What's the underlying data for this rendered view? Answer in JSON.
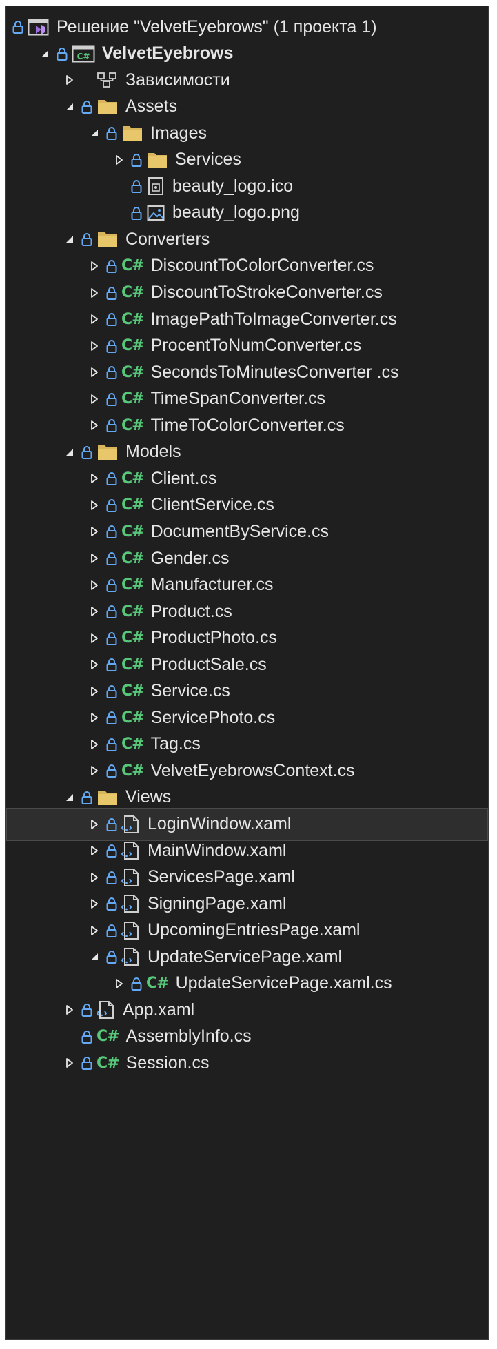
{
  "colors": {
    "background": "#1f1f1f",
    "text": "#e6e6e6",
    "lock_blue": "#64a9f5",
    "folder_yellow": "#d8b55a",
    "csharp_green": "#57c87a",
    "selection": "#2e2e2e"
  },
  "tree": [
    {
      "name": "Решение \"VelvetEyebrows\"  (1 проекта 1)",
      "depth": 0,
      "expander": "none",
      "icon": "solution-icon",
      "lock": true
    },
    {
      "name": "VelvetEyebrows",
      "depth": 1,
      "expander": "expanded",
      "icon": "csharp-project-icon",
      "lock": true,
      "bold": true
    },
    {
      "name": "Зависимости",
      "depth": 2,
      "expander": "collapsed",
      "icon": "dependencies-icon",
      "lock": false
    },
    {
      "name": "Assets",
      "depth": 2,
      "expander": "expanded",
      "icon": "folder-icon",
      "lock": true
    },
    {
      "name": "Images",
      "depth": 3,
      "expander": "expanded",
      "icon": "folder-icon",
      "lock": true
    },
    {
      "name": "Services",
      "depth": 4,
      "expander": "collapsed",
      "icon": "folder-icon",
      "lock": true
    },
    {
      "name": "beauty_logo.ico",
      "depth": 4,
      "expander": "none",
      "icon": "ico-file-icon",
      "lock": true
    },
    {
      "name": "beauty_logo.png",
      "depth": 4,
      "expander": "none",
      "icon": "image-file-icon",
      "lock": true
    },
    {
      "name": "Converters",
      "depth": 2,
      "expander": "expanded",
      "icon": "folder-icon",
      "lock": true
    },
    {
      "name": "DiscountToColorConverter.cs",
      "depth": 3,
      "expander": "collapsed",
      "icon": "csharp-file-icon",
      "lock": true
    },
    {
      "name": "DiscountToStrokeConverter.cs",
      "depth": 3,
      "expander": "collapsed",
      "icon": "csharp-file-icon",
      "lock": true
    },
    {
      "name": "ImagePathToImageConverter.cs",
      "depth": 3,
      "expander": "collapsed",
      "icon": "csharp-file-icon",
      "lock": true
    },
    {
      "name": "ProcentToNumConverter.cs",
      "depth": 3,
      "expander": "collapsed",
      "icon": "csharp-file-icon",
      "lock": true
    },
    {
      "name": "SecondsToMinutesConverter .cs",
      "depth": 3,
      "expander": "collapsed",
      "icon": "csharp-file-icon",
      "lock": true
    },
    {
      "name": "TimeSpanConverter.cs",
      "depth": 3,
      "expander": "collapsed",
      "icon": "csharp-file-icon",
      "lock": true
    },
    {
      "name": "TimeToColorConverter.cs",
      "depth": 3,
      "expander": "collapsed",
      "icon": "csharp-file-icon",
      "lock": true
    },
    {
      "name": "Models",
      "depth": 2,
      "expander": "expanded",
      "icon": "folder-icon",
      "lock": true
    },
    {
      "name": "Client.cs",
      "depth": 3,
      "expander": "collapsed",
      "icon": "csharp-file-icon",
      "lock": true
    },
    {
      "name": "ClientService.cs",
      "depth": 3,
      "expander": "collapsed",
      "icon": "csharp-file-icon",
      "lock": true
    },
    {
      "name": "DocumentByService.cs",
      "depth": 3,
      "expander": "collapsed",
      "icon": "csharp-file-icon",
      "lock": true
    },
    {
      "name": "Gender.cs",
      "depth": 3,
      "expander": "collapsed",
      "icon": "csharp-file-icon",
      "lock": true
    },
    {
      "name": "Manufacturer.cs",
      "depth": 3,
      "expander": "collapsed",
      "icon": "csharp-file-icon",
      "lock": true
    },
    {
      "name": "Product.cs",
      "depth": 3,
      "expander": "collapsed",
      "icon": "csharp-file-icon",
      "lock": true
    },
    {
      "name": "ProductPhoto.cs",
      "depth": 3,
      "expander": "collapsed",
      "icon": "csharp-file-icon",
      "lock": true
    },
    {
      "name": "ProductSale.cs",
      "depth": 3,
      "expander": "collapsed",
      "icon": "csharp-file-icon",
      "lock": true
    },
    {
      "name": "Service.cs",
      "depth": 3,
      "expander": "collapsed",
      "icon": "csharp-file-icon",
      "lock": true
    },
    {
      "name": "ServicePhoto.cs",
      "depth": 3,
      "expander": "collapsed",
      "icon": "csharp-file-icon",
      "lock": true
    },
    {
      "name": "Tag.cs",
      "depth": 3,
      "expander": "collapsed",
      "icon": "csharp-file-icon",
      "lock": true
    },
    {
      "name": "VelvetEyebrowsContext.cs",
      "depth": 3,
      "expander": "collapsed",
      "icon": "csharp-file-icon",
      "lock": true
    },
    {
      "name": "Views",
      "depth": 2,
      "expander": "expanded",
      "icon": "folder-icon",
      "lock": true
    },
    {
      "name": "LoginWindow.xaml",
      "depth": 3,
      "expander": "collapsed",
      "icon": "xaml-file-icon",
      "lock": true,
      "selected": true
    },
    {
      "name": "MainWindow.xaml",
      "depth": 3,
      "expander": "collapsed",
      "icon": "xaml-file-icon",
      "lock": true
    },
    {
      "name": "ServicesPage.xaml",
      "depth": 3,
      "expander": "collapsed",
      "icon": "xaml-file-icon",
      "lock": true
    },
    {
      "name": "SigningPage.xaml",
      "depth": 3,
      "expander": "collapsed",
      "icon": "xaml-file-icon",
      "lock": true
    },
    {
      "name": "UpcomingEntriesPage.xaml",
      "depth": 3,
      "expander": "collapsed",
      "icon": "xaml-file-icon",
      "lock": true
    },
    {
      "name": "UpdateServicePage.xaml",
      "depth": 3,
      "expander": "expanded",
      "icon": "xaml-file-icon",
      "lock": true
    },
    {
      "name": "UpdateServicePage.xaml.cs",
      "depth": 4,
      "expander": "collapsed",
      "icon": "csharp-file-icon",
      "lock": true
    },
    {
      "name": "App.xaml",
      "depth": 2,
      "expander": "collapsed",
      "icon": "xaml-file-icon",
      "lock": true
    },
    {
      "name": "AssemblyInfo.cs",
      "depth": 2,
      "expander": "none",
      "icon": "csharp-file-icon",
      "lock": true
    },
    {
      "name": "Session.cs",
      "depth": 2,
      "expander": "collapsed",
      "icon": "csharp-file-icon",
      "lock": true
    }
  ]
}
